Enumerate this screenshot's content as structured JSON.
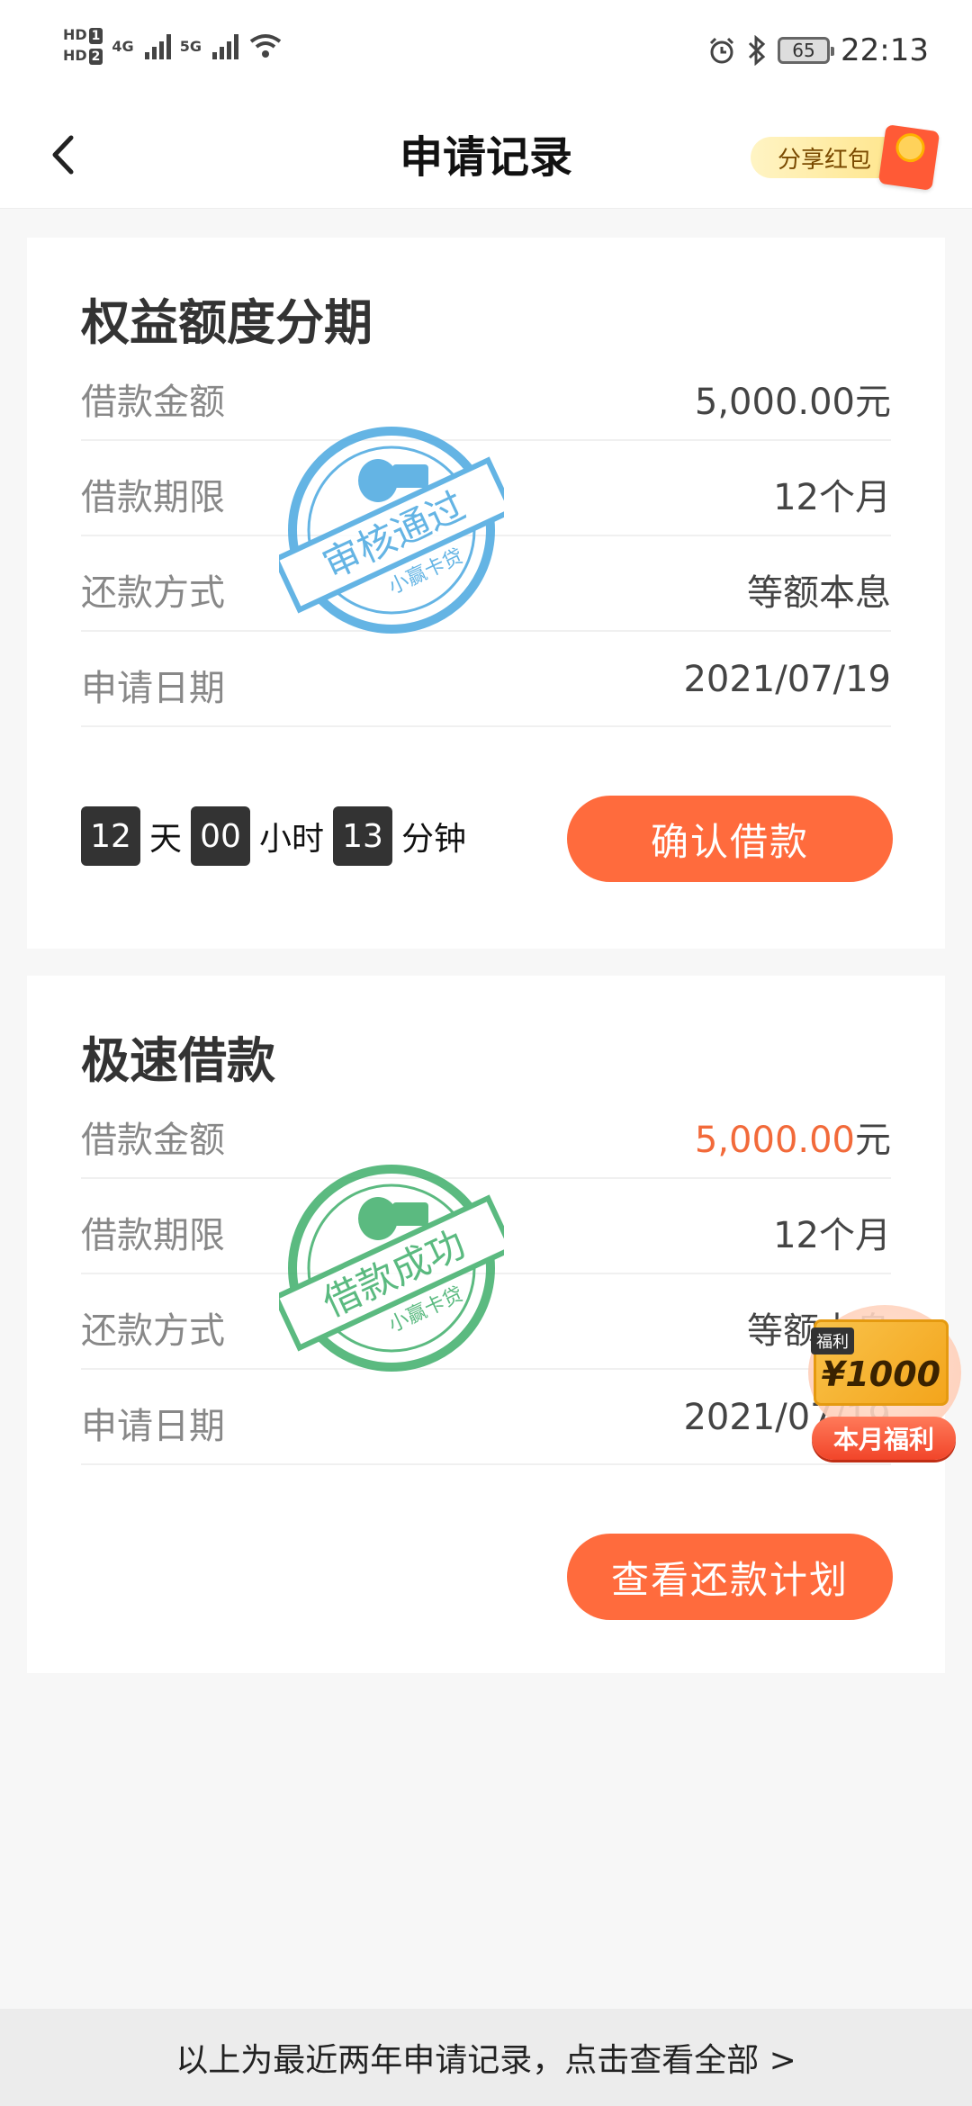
{
  "status_bar": {
    "hd1": "HD",
    "hd1_num": "1",
    "hd2": "HD",
    "hd2_num": "2",
    "net1": "4G",
    "net2": "5G",
    "battery": "65",
    "time": "22:13"
  },
  "nav": {
    "title": "申请记录",
    "share_label": "分享红包"
  },
  "cards": [
    {
      "title": "权益额度分期",
      "rows": [
        {
          "label": "借款金额",
          "value": "5,000.00元"
        },
        {
          "label": "借款期限",
          "value": "12个月"
        },
        {
          "label": "还款方式",
          "value": "等额本息"
        },
        {
          "label": "申请日期",
          "value": "2021/07/19"
        }
      ],
      "stamp": {
        "text": "审核通过",
        "sub": "小赢卡贷",
        "color": "#4aa8e0"
      },
      "countdown": {
        "days": "12",
        "days_unit": "天",
        "hours": "00",
        "hours_unit": "小时",
        "minutes": "13",
        "minutes_unit": "分钟"
      },
      "button": "确认借款"
    },
    {
      "title": "极速借款",
      "rows": [
        {
          "label": "借款金额",
          "value_highlight": "5,000.00",
          "value_unit": "元"
        },
        {
          "label": "借款期限",
          "value": "12个月"
        },
        {
          "label": "还款方式",
          "value": "等额本息"
        },
        {
          "label": "申请日期",
          "value": "2021/07/19"
        }
      ],
      "stamp": {
        "text": "借款成功",
        "sub": "小赢卡贷",
        "color": "#3fae6b"
      },
      "button": "查看还款计划"
    }
  ],
  "reward": {
    "tag": "福利",
    "amount": "¥1000",
    "label": "本月福利"
  },
  "footer": {
    "text": "以上为最近两年申请记录，点击查看全部 >"
  }
}
